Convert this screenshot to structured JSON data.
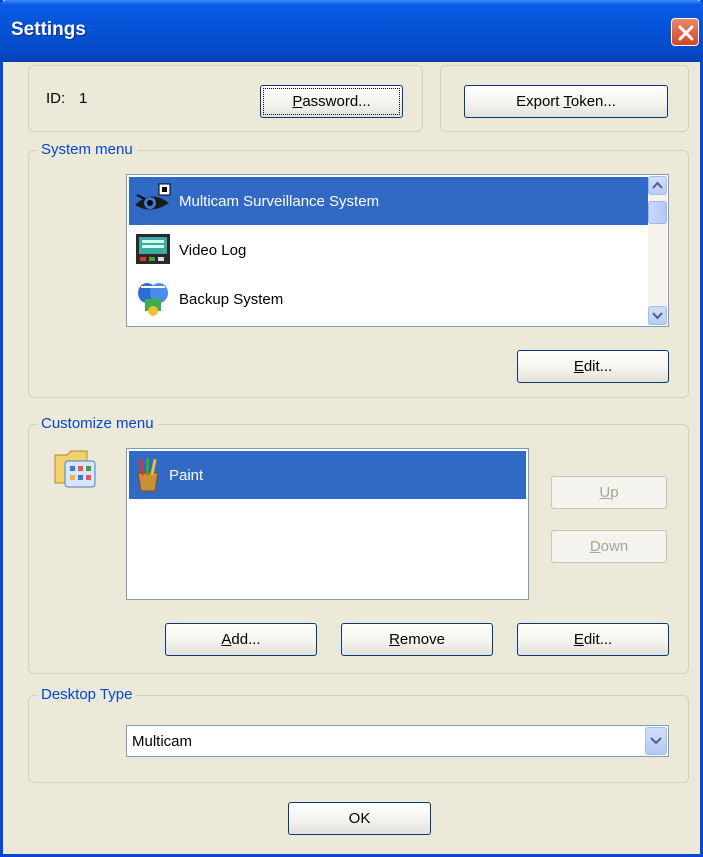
{
  "window": {
    "title": "Settings",
    "close_icon": "close-icon"
  },
  "account": {
    "id_label": "ID:",
    "id_value": "1",
    "password_button": {
      "mnemonic": "P",
      "rest": "assword..."
    },
    "export_button": {
      "before": "Export ",
      "mnemonic": "T",
      "rest": "oken..."
    }
  },
  "system_menu": {
    "legend": "System menu",
    "items": [
      {
        "label": "Multicam Surveillance System",
        "icon": "surveillance-eye-icon",
        "selected": true
      },
      {
        "label": "Video Log",
        "icon": "video-log-icon",
        "selected": false
      },
      {
        "label": "Backup System",
        "icon": "backup-system-icon",
        "selected": false
      }
    ],
    "edit_button": {
      "mnemonic": "E",
      "rest": "dit..."
    }
  },
  "customize_menu": {
    "legend": "Customize menu",
    "folder_icon": "program-folder-icon",
    "items": [
      {
        "label": "Paint",
        "icon": "paint-brushes-icon",
        "selected": true
      }
    ],
    "up_button": {
      "mnemonic": "U",
      "rest": "p"
    },
    "down_button": {
      "mnemonic": "D",
      "rest": "own"
    },
    "add_button": {
      "mnemonic": "A",
      "rest": "dd..."
    },
    "remove_button": {
      "mnemonic": "R",
      "rest": "emove"
    },
    "edit_button": {
      "mnemonic": "E",
      "rest": "dit..."
    }
  },
  "desktop_type": {
    "legend": "Desktop Type",
    "selected": "Multicam"
  },
  "ok_button": "OK",
  "colors": {
    "selection": "#316ac5",
    "titlebar": "#0654d8",
    "group_legend": "#0046d5",
    "dialog_face": "#ece9d8"
  }
}
